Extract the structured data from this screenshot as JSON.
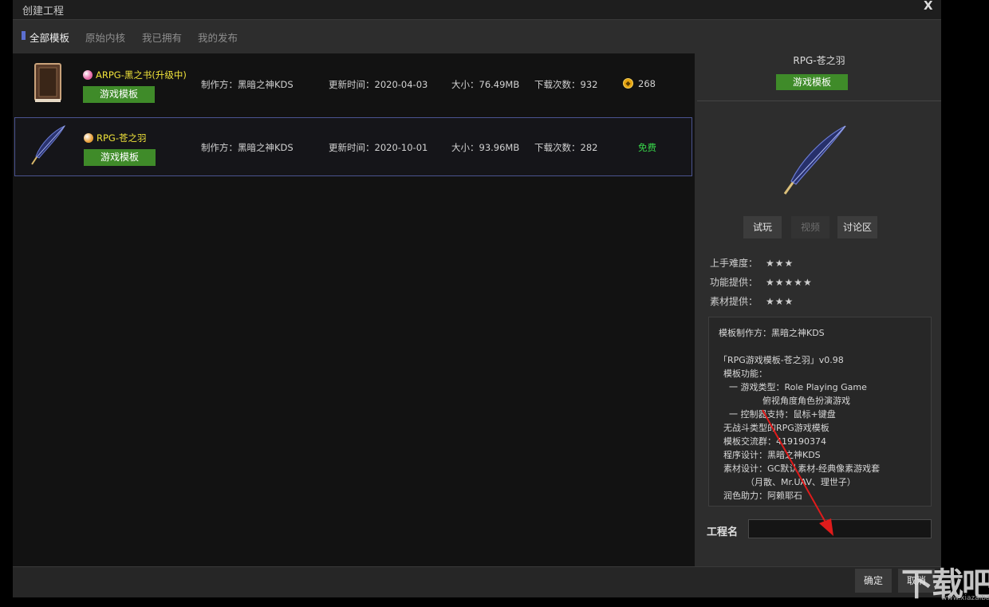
{
  "window": {
    "title": "创建工程",
    "close_label": "X"
  },
  "tabs": [
    {
      "label": "全部模板"
    },
    {
      "label": "原始内核"
    },
    {
      "label": "我已拥有"
    },
    {
      "label": "我的发布"
    }
  ],
  "templates": [
    {
      "name": "ARPG-黑之书(升级中)",
      "tag": "游戏模板",
      "author": "制作方：黑暗之神KDS",
      "updated": "更新时间：2020-04-03",
      "size": "大小：76.49MB",
      "downloads": "下载次数：932",
      "price": "268",
      "gem_color": "#e86aa8"
    },
    {
      "name": "RPG-苍之羽",
      "tag": "游戏模板",
      "author": "制作方：黑暗之神KDS",
      "updated": "更新时间：2020-10-01",
      "size": "大小：93.96MB",
      "downloads": "下载次数：282",
      "price": "免费",
      "gem_color": "#e8a03a"
    }
  ],
  "detail": {
    "title": "RPG-苍之羽",
    "tag": "游戏模板",
    "buttons": {
      "trial": "试玩",
      "video": "视频",
      "forum": "讨论区"
    },
    "ratings": [
      {
        "label": "上手难度：",
        "stars": "★★★",
        "value": 3
      },
      {
        "label": "功能提供：",
        "stars": "★★★★★",
        "value": 5
      },
      {
        "label": "素材提供：",
        "stars": "★★★",
        "value": 3
      }
    ],
    "description": [
      "模板制作方：黑暗之神KDS",
      "",
      "「RPG游戏模板-苍之羽」v0.98",
      "模板功能：",
      "  一 游戏类型：Role Playing Game",
      "              俯视角度角色扮演游戏",
      "  一 控制器支持：鼠标+键盘",
      "无战斗类型的RPG游戏模板",
      "模板交流群：419190374",
      "程序设计：黑暗之神KDS",
      "素材设计：GC默认素材-经典像素游戏套",
      "        （月散、Mr.UAV、理世子）",
      "润色助力：阿赖耶石"
    ]
  },
  "project": {
    "label": "工程名",
    "value": "",
    "placeholder": ""
  },
  "footer": {
    "ok": "确定",
    "cancel": "取消"
  },
  "watermark": {
    "text": "下载吧",
    "url": "www.xiazaiba.com"
  },
  "colors": {
    "accent_green": "#3f8b29",
    "template_name": "#f0e33a",
    "free_text": "#38d64a",
    "selection_border": "#4b5490",
    "annotation_arrow": "#e01b1b"
  }
}
